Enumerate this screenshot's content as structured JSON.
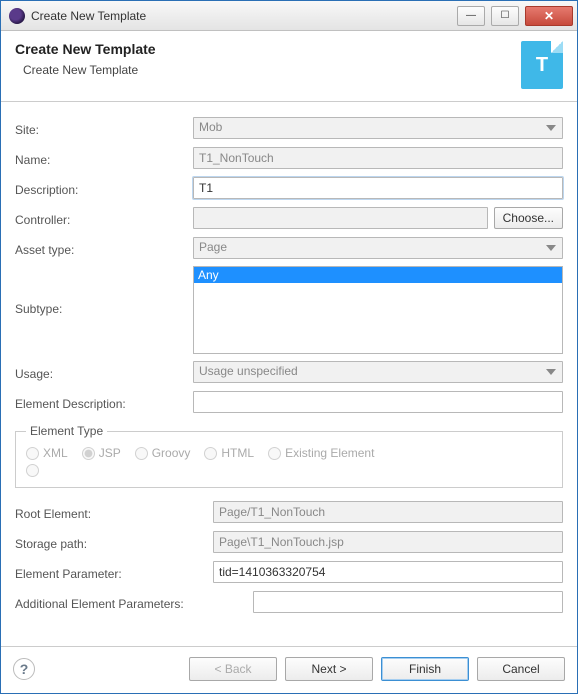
{
  "window": {
    "title": "Create New Template"
  },
  "header": {
    "title": "Create New Template",
    "subtitle": "Create New Template"
  },
  "labels": {
    "site": "Site:",
    "name": "Name:",
    "description": "Description:",
    "controller": "Controller:",
    "choose": "Choose...",
    "asset_type": "Asset type:",
    "subtype": "Subtype:",
    "usage": "Usage:",
    "element_description": "Element Description:",
    "element_type": "Element Type",
    "root_element": "Root Element:",
    "storage_path": "Storage path:",
    "element_parameter": "Element Parameter:",
    "additional_params": "Additional Element Parameters:"
  },
  "values": {
    "site": "Mob",
    "name": "T1_NonTouch",
    "description": "T1",
    "controller": "",
    "asset_type": "Page",
    "subtype_selected": "Any",
    "usage": "Usage unspecified",
    "element_description": "",
    "root_element": "Page/T1_NonTouch",
    "storage_path": "Page\\T1_NonTouch.jsp",
    "element_parameter": "tid=1410363320754",
    "additional_params": ""
  },
  "element_types": {
    "xml": "XML",
    "jsp": "JSP",
    "groovy": "Groovy",
    "html": "HTML",
    "existing": "Existing Element",
    "selected": "jsp"
  },
  "footer": {
    "back": "< Back",
    "next": "Next >",
    "finish": "Finish",
    "cancel": "Cancel"
  }
}
